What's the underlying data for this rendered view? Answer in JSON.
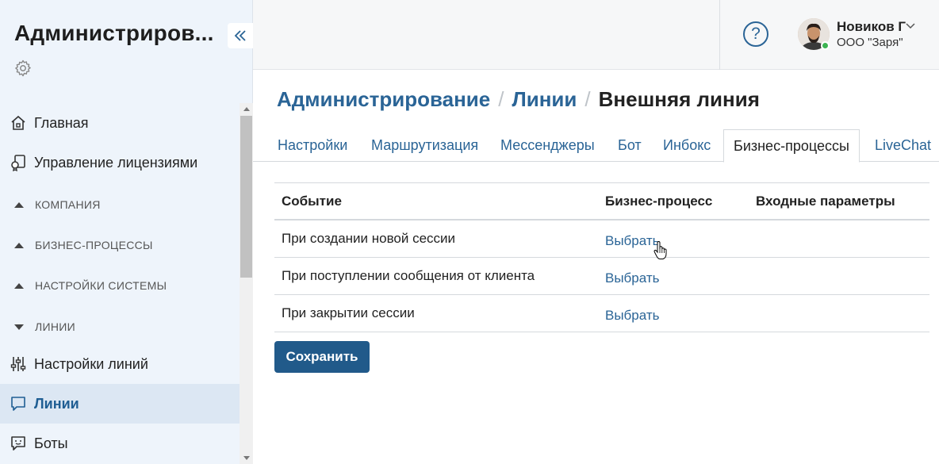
{
  "sidebar": {
    "title": "Администриров...",
    "items": [
      {
        "label": "Главная",
        "icon": "home-icon"
      },
      {
        "label": "Управление лицензиями",
        "icon": "license-icon"
      }
    ],
    "groups": [
      {
        "label": "КОМПАНИЯ",
        "state": "collapsed"
      },
      {
        "label": "БИЗНЕС-ПРОЦЕССЫ",
        "state": "collapsed"
      },
      {
        "label": "НАСТРОЙКИ СИСТЕМЫ",
        "state": "collapsed"
      },
      {
        "label": "ЛИНИИ",
        "state": "expanded"
      }
    ],
    "sub_items": [
      {
        "label": "Настройки линий",
        "icon": "sliders-icon"
      },
      {
        "label": "Линии",
        "icon": "chat-icon",
        "active": true
      },
      {
        "label": "Боты",
        "icon": "bot-icon"
      }
    ]
  },
  "header": {
    "help_glyph": "?",
    "user_name": "Новиков Г",
    "user_org": "ООО \"Заря\"",
    "online_color": "#3cb452"
  },
  "breadcrumb": {
    "items": [
      "Администрирование",
      "Линии"
    ],
    "current": "Внешняя линия",
    "separator": "/"
  },
  "tabs": [
    {
      "label": "Настройки"
    },
    {
      "label": "Маршрутизация"
    },
    {
      "label": "Мессенджеры"
    },
    {
      "label": "Бот"
    },
    {
      "label": "Инбокс"
    },
    {
      "label": "Бизнес-процессы",
      "active": true
    },
    {
      "label": "LiveChat"
    }
  ],
  "table": {
    "headers": [
      "Событие",
      "Бизнес-процесс",
      "Входные параметры"
    ],
    "rows": [
      {
        "event": "При создании новой сессии",
        "action": "Выбрать"
      },
      {
        "event": "При поступлении сообщения от клиента",
        "action": "Выбрать"
      },
      {
        "event": "При закрытии сессии",
        "action": "Выбрать"
      }
    ]
  },
  "save_label": "Сохранить",
  "colors": {
    "accent": "#2a6496",
    "button": "#215a8a",
    "sidebar_bg": "#eef4fb",
    "sidebar_active": "#dce7f3"
  }
}
